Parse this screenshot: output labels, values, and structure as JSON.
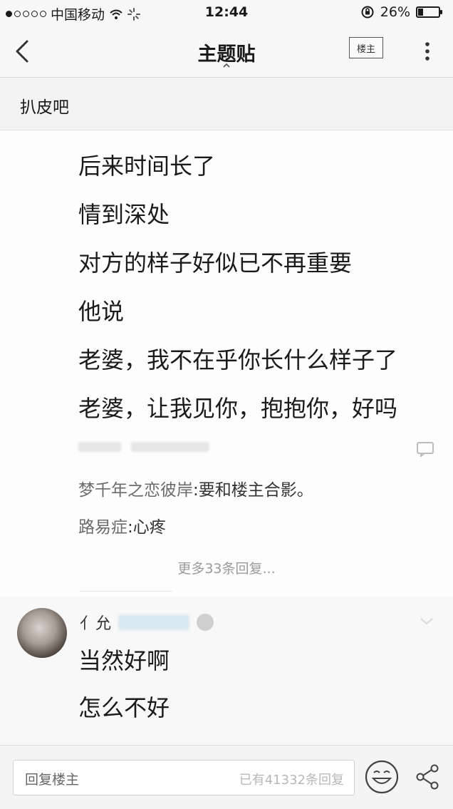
{
  "status_bar": {
    "carrier": "中国移动",
    "time": "12:44",
    "battery_percent": "26%",
    "battery_level": 0.26
  },
  "nav": {
    "title": "主题贴",
    "louzhu_button": "楼主"
  },
  "forum": {
    "name": "扒皮吧"
  },
  "post": {
    "lines": [
      "后来时间长了",
      "情到深处",
      "对方的样子好似已不再重要",
      "他说",
      "老婆，我不在乎你长什么样子了",
      "老婆，让我见你，抱抱你，好吗"
    ]
  },
  "sub_replies": [
    {
      "user": "梦千年之恋彼岸",
      "separator": ":",
      "text": "要和楼主合影。"
    },
    {
      "user": "路易症",
      "separator": ":",
      "text": "心疼"
    }
  ],
  "more_replies": "更多33条回复...",
  "floor": {
    "user_name": "亻允",
    "lines": [
      "当然好啊",
      "怎么不好"
    ]
  },
  "reply_bar": {
    "placeholder": "回复楼主",
    "count_text": "已有41332条回复"
  }
}
